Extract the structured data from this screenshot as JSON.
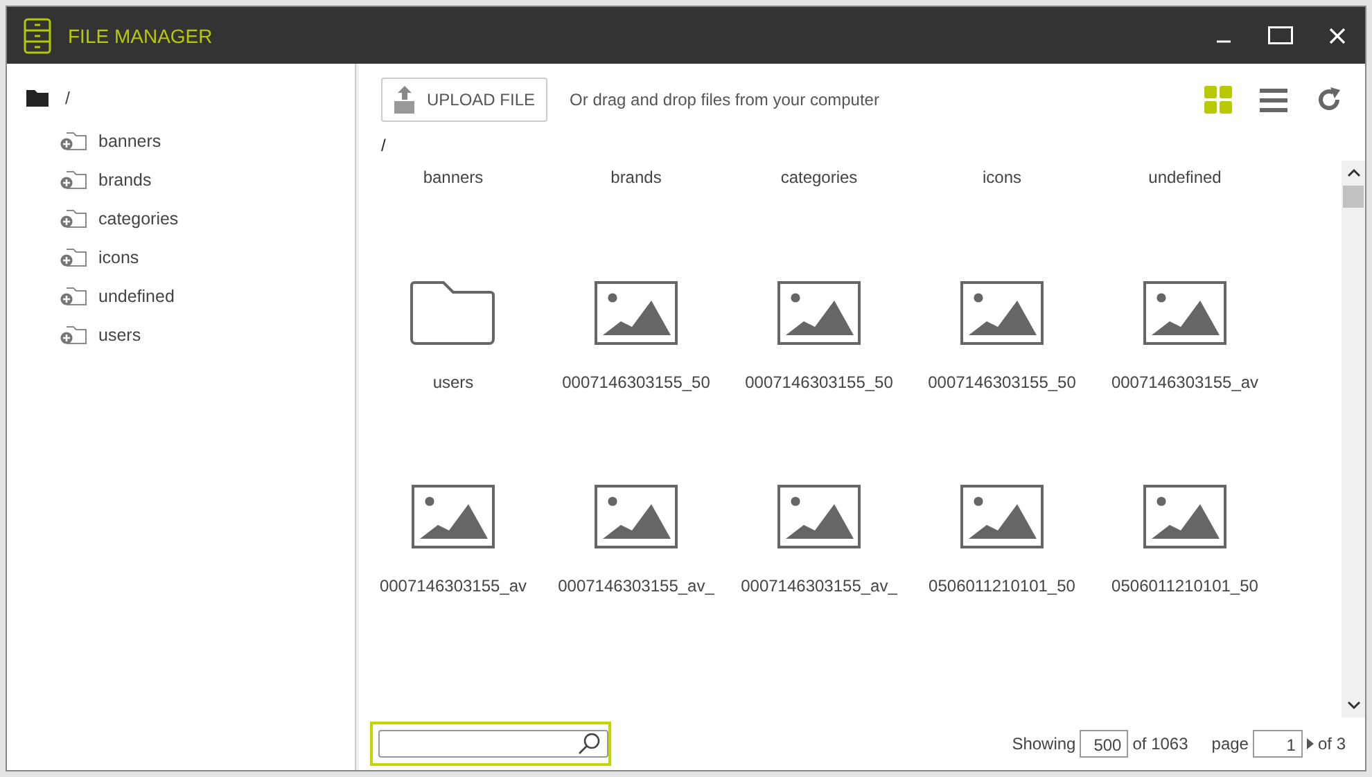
{
  "window": {
    "title": "FILE MANAGER"
  },
  "tree": {
    "label": "/",
    "children": [
      {
        "label": "banners"
      },
      {
        "label": "brands"
      },
      {
        "label": "categories"
      },
      {
        "label": "icons"
      },
      {
        "label": "undefined"
      },
      {
        "label": "users"
      }
    ]
  },
  "toolbar": {
    "upload_button": "UPLOAD FILE",
    "hint": "Or drag and drop files from your computer",
    "views": [
      {
        "kind": "grid",
        "selected": true
      },
      {
        "kind": "list",
        "selected": false
      }
    ]
  },
  "breadcrumb": "/",
  "items": [
    {
      "name": "banners"
    },
    {
      "name": "brands"
    },
    {
      "name": "categories"
    },
    {
      "name": "icons"
    },
    {
      "name": "undefined"
    },
    {
      "kind": "folder",
      "name": "users"
    },
    {
      "kind": "image",
      "name": "0007146303155_50"
    },
    {
      "kind": "image",
      "name": "0007146303155_50"
    },
    {
      "kind": "image",
      "name": "0007146303155_50"
    },
    {
      "kind": "image",
      "name": "0007146303155_av"
    },
    {
      "kind": "image",
      "name": "0007146303155_av"
    },
    {
      "kind": "image",
      "name": "0007146303155_av_"
    },
    {
      "kind": "image",
      "name": "0007146303155_av_"
    },
    {
      "kind": "image",
      "name": "0506011210101_50"
    },
    {
      "kind": "image",
      "name": "0506011210101_50"
    }
  ],
  "footer": {
    "showing_label": "Showing",
    "per_page": "500",
    "total": "of 1063",
    "page_label": "page",
    "page": "1",
    "pages": "of 3"
  }
}
